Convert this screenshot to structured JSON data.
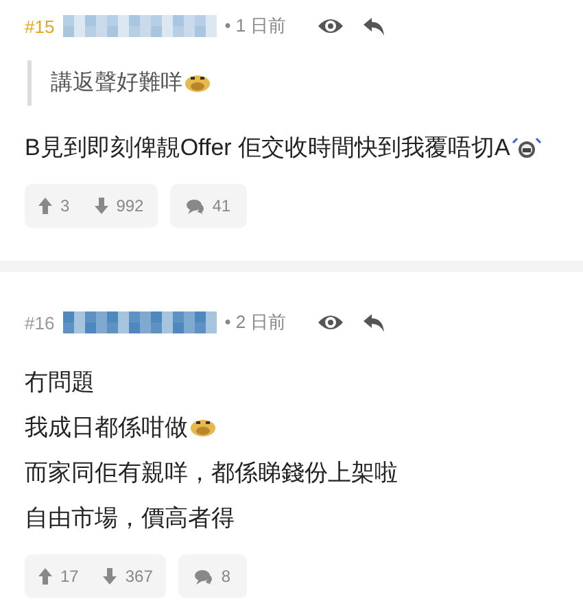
{
  "posts": [
    {
      "number": "#15",
      "author_highlight": true,
      "time": "• 1 日前",
      "quote": {
        "text": "講返聲好難咩",
        "kind": "sweat"
      },
      "lines": [
        {
          "text": "B見到即刻俾靚Offer 佢交收時間快到我覆唔切A",
          "kind": "angry"
        }
      ],
      "upvotes": "3",
      "downvotes": "992",
      "replies": "41"
    },
    {
      "number": "#16",
      "author_highlight": false,
      "time": "• 2 日前",
      "lines": [
        {
          "text": "冇問題",
          "kind": "plain"
        },
        {
          "text": "我成日都係咁做",
          "kind": "sweat"
        },
        {
          "text": "而家同佢有親咩，都係睇錢份上架啦",
          "kind": "plain"
        },
        {
          "text": "自由市場，價高者得",
          "kind": "plain"
        }
      ],
      "upvotes": "17",
      "downvotes": "367",
      "replies": "8"
    }
  ]
}
